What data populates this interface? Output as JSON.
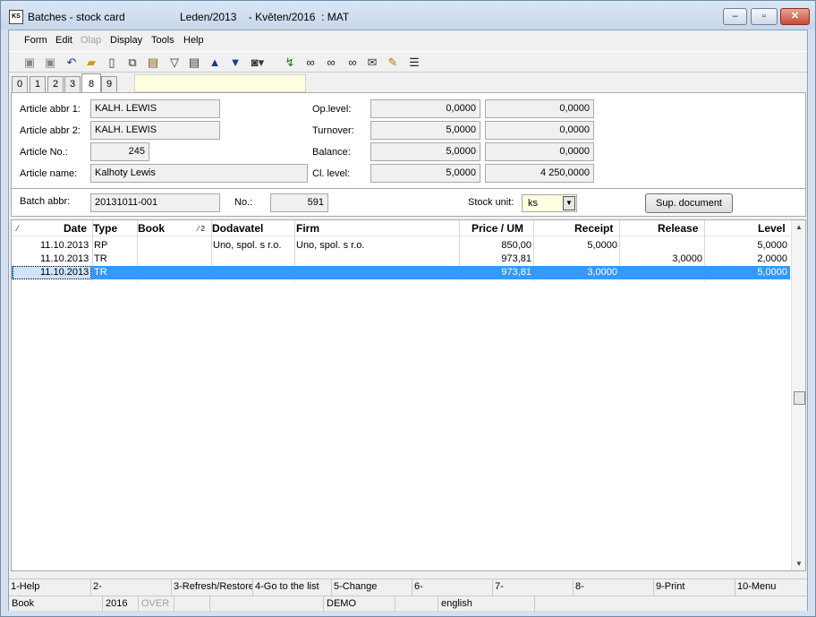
{
  "window": {
    "app_icon": "KS",
    "title": "Batches - stock card",
    "period": "Leden/2013    - Květen/2016  : MAT",
    "min_symbol": "–",
    "max_symbol": "▫",
    "close_symbol": "✕"
  },
  "menu": [
    "Form",
    "Edit",
    "Olap",
    "Display",
    "Tools",
    "Help"
  ],
  "toolbar_icons": [
    "save-icon",
    "save-as-icon",
    "undo-icon",
    "open-folder-icon",
    "new-document-icon",
    "copy-icon",
    "book-icon",
    "filter-icon",
    "filter-doc-icon",
    "arrow-up-icon",
    "arrow-down-icon",
    "camera-icon",
    "refresh-icon",
    "binoculars-icon",
    "find-next-icon",
    "find-prev-icon",
    "mail-icon",
    "edit-doc-icon",
    "list-icon"
  ],
  "tabs": [
    "0",
    "1",
    "2",
    "3",
    "8",
    "9"
  ],
  "active_tab": "8",
  "header": {
    "article_abbr1_label": "Article abbr 1:",
    "article_abbr1": "KALH. LEWIS",
    "article_abbr2_label": "Article abbr 2:",
    "article_abbr2": "KALH. LEWIS",
    "article_no_label": "Article No.:",
    "article_no": "245",
    "article_name_label": "Article name:",
    "article_name": "Kalhoty Lewis",
    "op_level_label": "Op.level:",
    "op_level_1": "0,0000",
    "op_level_2": "0,0000",
    "turnover_label": "Turnover:",
    "turnover_1": "5,0000",
    "turnover_2": "0,0000",
    "balance_label": "Balance:",
    "balance_1": "5,0000",
    "balance_2": "0,0000",
    "cl_level_label": "Cl. level:",
    "cl_level_1": "5,0000",
    "cl_level_2": "4 250,0000"
  },
  "batch": {
    "batch_abbr_label": "Batch abbr:",
    "batch_abbr": "20131011-001",
    "no_label": "No.:",
    "no": "591",
    "stock_unit_label": "Stock unit:",
    "stock_unit": "ks",
    "sup_document_label": "Sup. document"
  },
  "grid": {
    "sort_marker_date": "⁄",
    "sort_marker_book": "⁄ 2",
    "columns": [
      "Date",
      "Type",
      "Book",
      "Dodavatel",
      "Firm",
      "Price / UM",
      "Receipt",
      "Release",
      "Level"
    ],
    "rows": [
      {
        "date": "11.10.2013",
        "type": "RP",
        "book": "",
        "dodavatel": "Uno, spol. s r.o.",
        "firm": "Uno, spol. s r.o.",
        "price": "850,00",
        "receipt": "5,0000",
        "release": "",
        "level": "5,0000"
      },
      {
        "date": "11.10.2013",
        "type": "TR",
        "book": "",
        "dodavatel": "",
        "firm": "",
        "price": "973,81",
        "receipt": "",
        "release": "3,0000",
        "level": "2,0000"
      },
      {
        "date": "11.10.2013",
        "type": "TR",
        "book": "",
        "dodavatel": "",
        "firm": "",
        "price": "973,81",
        "receipt": "3,0000",
        "release": "",
        "level": "5,0000"
      }
    ],
    "selected_row": 2
  },
  "fkeys": [
    "1-Help",
    "2-",
    "3-Refresh/Restore",
    "4-Go to the list",
    "5-Change",
    "6-",
    "7-",
    "8-",
    "9-Print",
    "10-Menu"
  ],
  "status": [
    "Book",
    "2016",
    "OVER",
    "",
    "",
    "DEMO",
    "",
    "english",
    ""
  ]
}
